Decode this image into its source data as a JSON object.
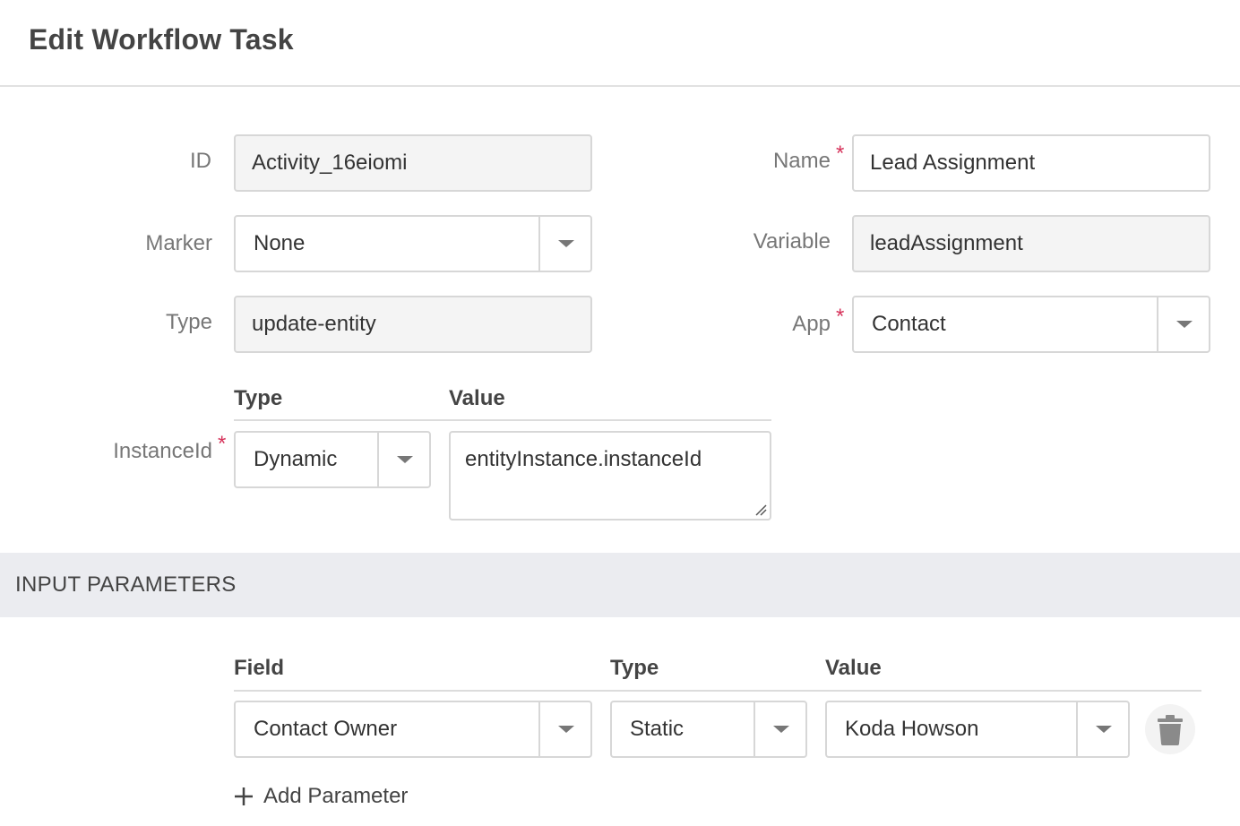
{
  "header": {
    "title": "Edit Workflow Task"
  },
  "form": {
    "id_label": "ID",
    "id_value": "Activity_16eiomi",
    "name_label": "Name",
    "name_value": "Lead Assignment",
    "marker_label": "Marker",
    "marker_value": "None",
    "variable_label": "Variable",
    "variable_value": "leadAssignment",
    "type_label": "Type",
    "type_value": "update-entity",
    "app_label": "App",
    "app_value": "Contact",
    "required_mark": "*",
    "instance": {
      "type_header": "Type",
      "value_header": "Value",
      "label": "InstanceId",
      "type_value": "Dynamic",
      "value": "entityInstance.instanceId"
    }
  },
  "input_parameters": {
    "section_title": "INPUT PARAMETERS",
    "headers": {
      "field": "Field",
      "type": "Type",
      "value": "Value"
    },
    "rows": [
      {
        "field": "Contact Owner",
        "type": "Static",
        "value": "Koda Howson"
      }
    ],
    "add_label": "Add Parameter"
  },
  "icons": {
    "dropdown": "chevron-down-icon",
    "delete": "trash-icon",
    "add": "plus-icon",
    "resize": "resize-grip-icon"
  },
  "colors": {
    "required": "#d6335b",
    "readonly_bg": "#f4f4f4",
    "section_bg": "#ebecf0",
    "border": "#d7d7d7"
  }
}
